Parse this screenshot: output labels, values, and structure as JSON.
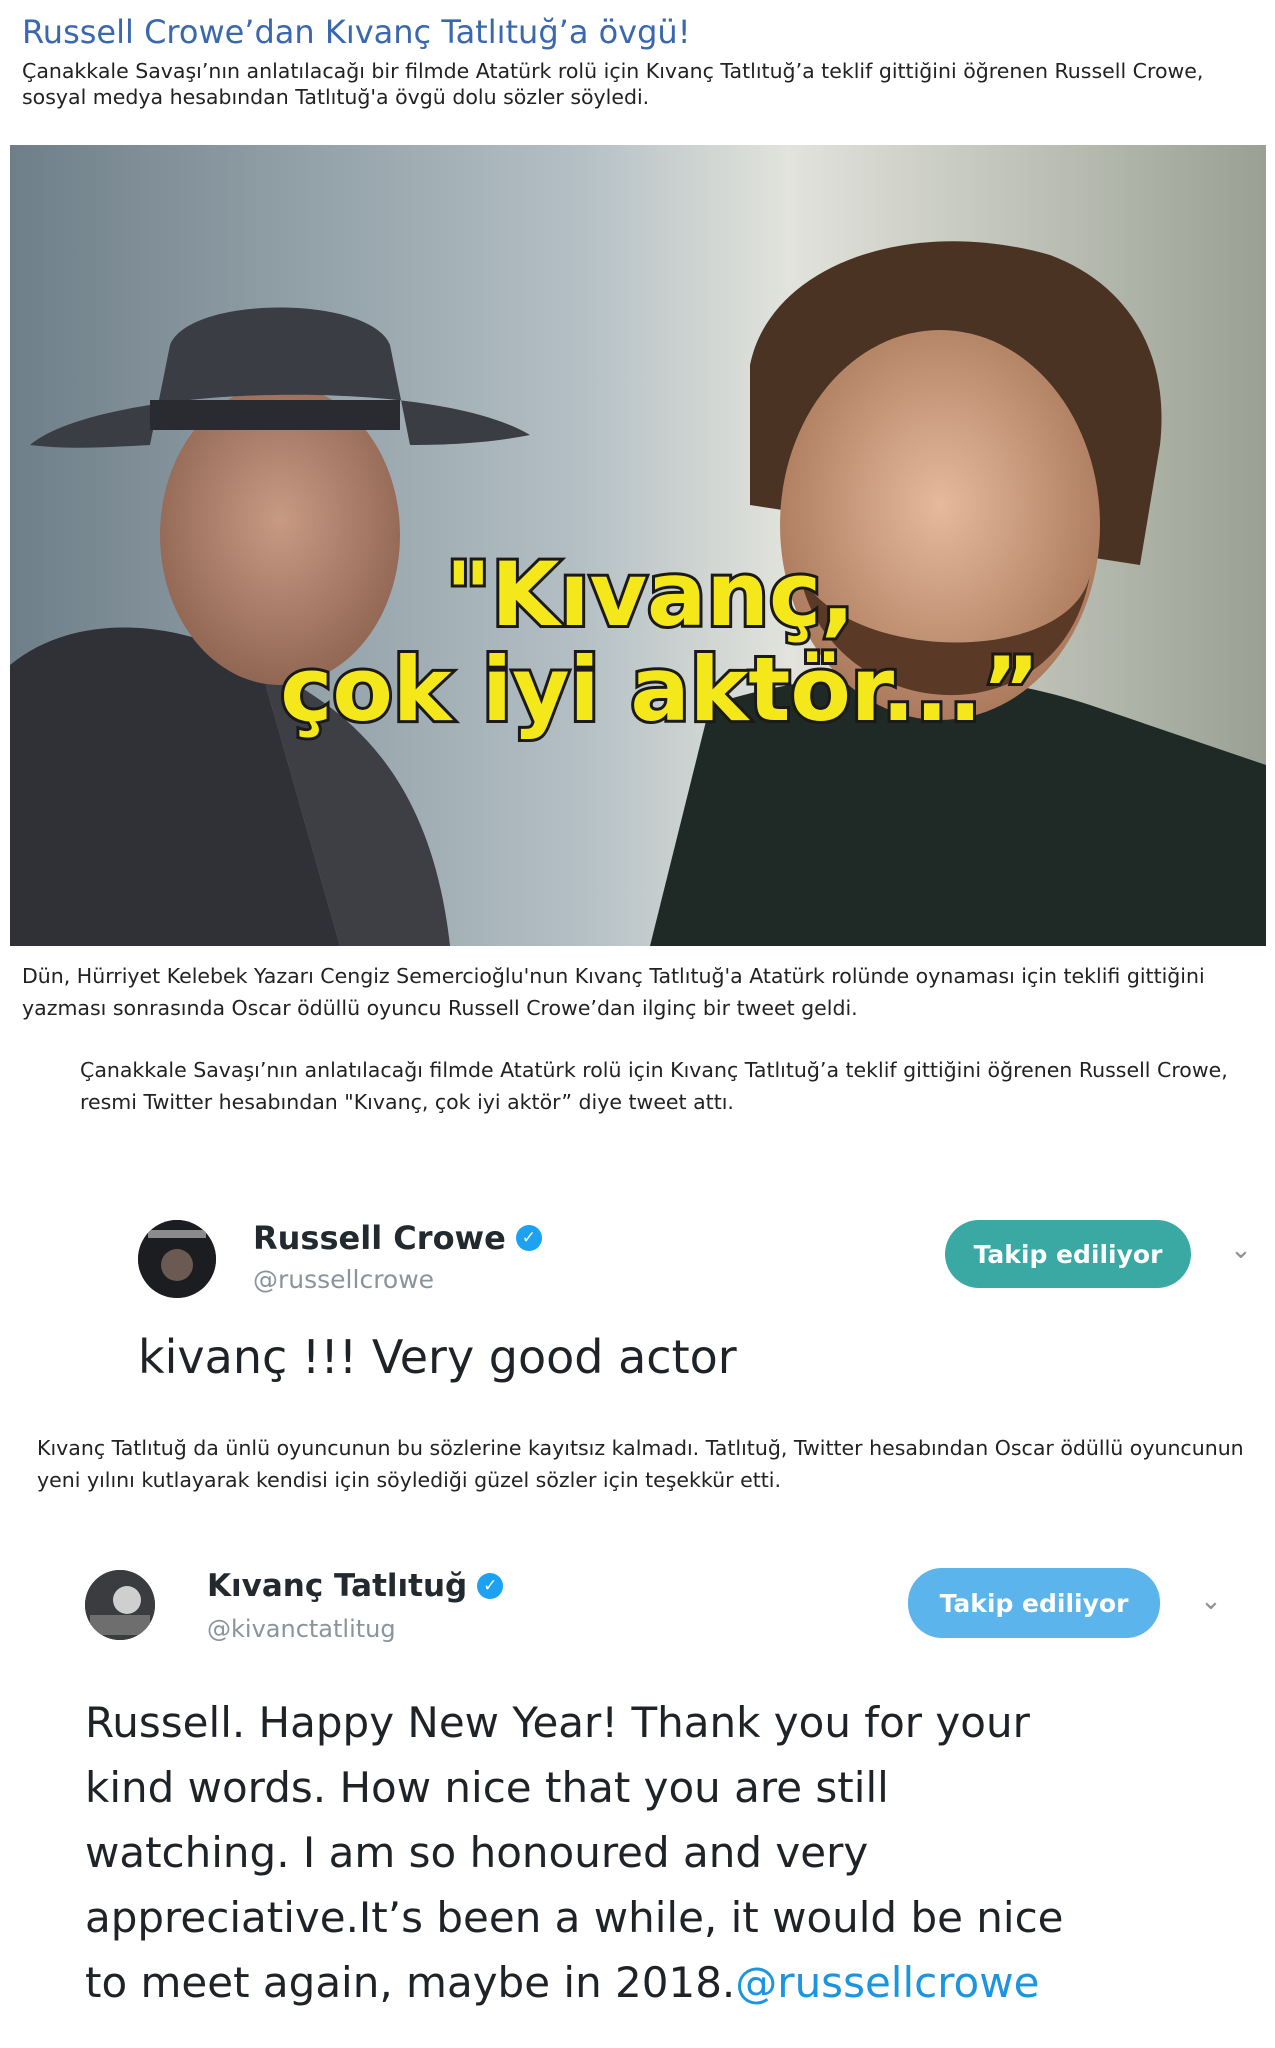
{
  "article": {
    "title": "Russell Crowe’dan Kıvanç Tatlıtuğ’a övgü!",
    "lead": "Çanakkale Savaşı’nın anlatılacağı bir filmde Atatürk rolü için Kıvanç Tatlıtuğ’a teklif gittiğini öğrenen Russell Crowe, sosyal medya hesabından Tatlıtuğ'a övgü dolu sözler söyledi.",
    "image_caption_overlay": [
      "\"Kıvanç,",
      "çok iyi aktör...”"
    ],
    "paragraph1": "Dün, Hürriyet Kelebek Yazarı Cengiz Semercioğlu'nun Kıvanç Tatlıtuğ'a Atatürk rolünde oynaması için teklifi gittiğini yazması sonrasında Oscar ödüllü oyuncu Russell Crowe’dan ilginç bir tweet geldi.",
    "paragraph2": "Çanakkale Savaşı’nın anlatılacağı filmde Atatürk rolü için Kıvanç Tatlıtuğ’a teklif gittiğini öğrenen Russell Crowe, resmi Twitter hesabından \"Kıvanç, çok iyi aktör” diye tweet attı.",
    "paragraph3": "Kıvanç Tatlıtuğ da ünlü oyuncunun bu sözlerine kayıtsız kalmadı. Tatlıtuğ, Twitter hesabından Oscar ödüllü oyuncunun yeni yılını kutlayarak kendisi için söylediği güzel sözler için teşekkür etti."
  },
  "tweet1": {
    "name": "Russell Crowe",
    "handle": "@russellcrowe",
    "follow_label": "Takip ediliyor",
    "text": "kivanç !!! Very good actor",
    "button_color": "#3aa8a3"
  },
  "tweet2": {
    "name": "Kıvanç Tatlıtuğ",
    "handle": "@kivanctatlitug",
    "follow_label": "Takip ediliyor",
    "text_lines": [
      "Russell. Happy New Year! Thank you for your",
      "kind words. How nice that you are still",
      "watching. I am so honoured and very",
      "appreciative.It’s been a while, it would be nice",
      "to meet again, maybe in 2018."
    ],
    "mention": "@russellcrowe",
    "button_color": "#5bb4ec"
  },
  "colors": {
    "title": "#3a68b0",
    "overlay_text": "#f5e81a",
    "verified": "#1da1f2",
    "mention": "#1b95e0"
  },
  "icons": [
    "verified-badge-icon",
    "chevron-down-icon"
  ]
}
